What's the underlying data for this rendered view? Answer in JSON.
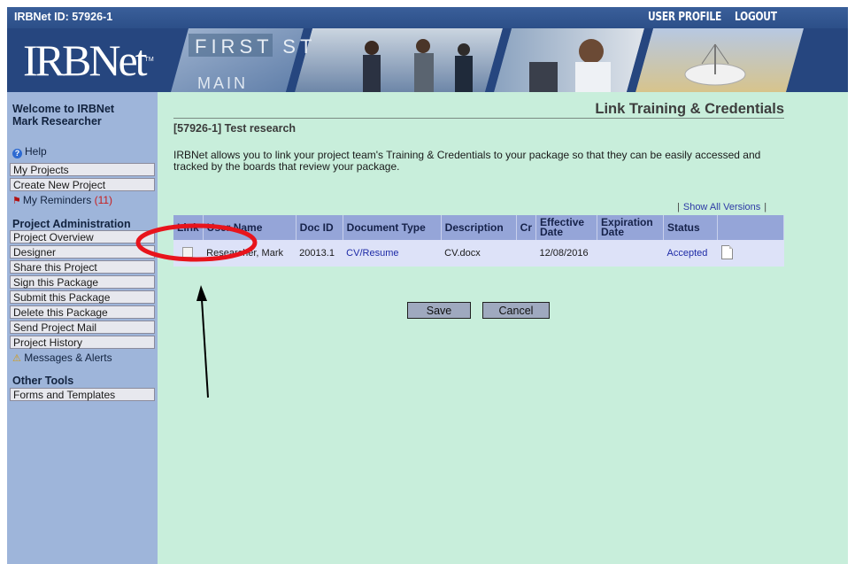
{
  "header": {
    "irbnet_id": "IRBNet ID: 57926-1",
    "user_profile": "USER PROFILE",
    "logout": "LOGOUT"
  },
  "banner": {
    "logo": "IRBNet",
    "logo_tm": "TM",
    "sign_text": "FIRST ST",
    "sign_text2": "MAIN"
  },
  "sidebar": {
    "welcome_line1": "Welcome to IRBNet",
    "welcome_line2": "Mark Researcher",
    "help": "Help",
    "my_projects": "My Projects",
    "create_new_project": "Create New Project",
    "my_reminders": "My Reminders",
    "reminders_count": "(11)",
    "project_admin_heading": "Project Administration",
    "admin_items": [
      "Project Overview",
      "Designer",
      "Share this Project",
      "Sign this Package",
      "Submit this Package",
      "Delete this Package",
      "Send Project Mail",
      "Project History"
    ],
    "messages_alerts": "Messages & Alerts",
    "other_tools_heading": "Other Tools",
    "forms_and_templates": "Forms and Templates"
  },
  "main": {
    "page_title": "Link Training & Credentials",
    "project_name": "[57926-1] Test research",
    "intro": "IRBNet allows you to link your project team's Training & Credentials to your package so that they can be easily accessed and tracked by the boards that review your package.",
    "show_all_versions": "Show All Versions",
    "bar": "|"
  },
  "table": {
    "headers": [
      "Link",
      "User Name",
      "Doc ID",
      "Document Type",
      "Description",
      "Cr",
      "Effective Date",
      "Expiration Date",
      "Status",
      ""
    ],
    "rows": [
      {
        "user_name": "Researcher, Mark",
        "doc_id": "20013.1",
        "document_type": "CV/Resume",
        "description": "CV.docx",
        "cr": "",
        "effective_date": "12/08/2016",
        "expiration_date": "",
        "status": "Accepted"
      }
    ]
  },
  "buttons": {
    "save": "Save",
    "cancel": "Cancel"
  },
  "colors": {
    "top_bar": "#2c4f88",
    "sidebar": "#9eb5da",
    "main_bg": "#c8eedb",
    "table_header": "#95a5d8",
    "annotation_red": "#e8141c"
  },
  "icons": [
    "help-icon",
    "reminder-flag-icon",
    "alert-icon",
    "document-icon"
  ]
}
